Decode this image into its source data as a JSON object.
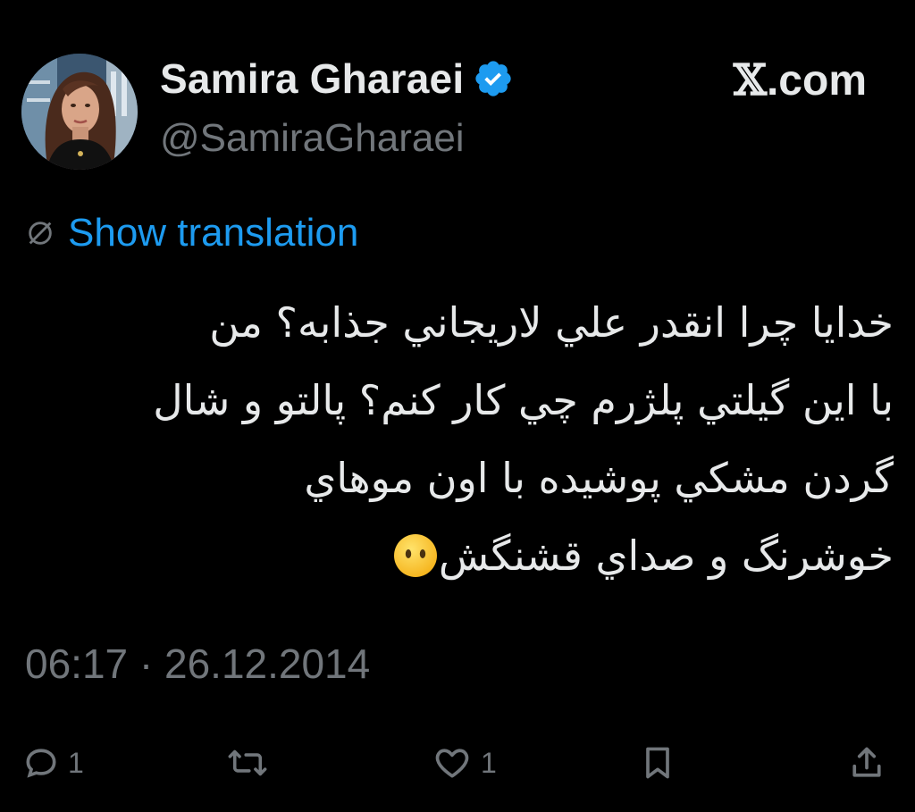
{
  "author": {
    "display_name": "Samira Gharaei",
    "handle": "@SamiraGharaei",
    "verified": true
  },
  "brand": {
    "text": ".com",
    "x_glyph": "𝕏"
  },
  "translation": {
    "label": "Show translation",
    "icon": "globe-icon"
  },
  "tweet": {
    "lines": [
      "خدايا چرا انقدر علي لاريجاني جذابه؟ من",
      "با اين گيلتي پلژرم چي كار كنم؟ پالتو و شال",
      "گردن مشكي پوشيده با اون موهاي",
      "خوشرنگ و صداي قشنگش"
    ],
    "emoji": "face-without-mouth"
  },
  "meta": {
    "timestamp": "06:17 · 26.12.2014"
  },
  "actions": {
    "reply": {
      "icon": "reply-icon",
      "count": "1"
    },
    "retweet": {
      "icon": "retweet-icon",
      "count": ""
    },
    "like": {
      "icon": "heart-icon",
      "count": "1"
    },
    "bookmark": {
      "icon": "bookmark-icon"
    },
    "share": {
      "icon": "share-icon"
    }
  },
  "colors": {
    "background": "#000000",
    "text_primary": "#e7e9ea",
    "text_secondary": "#71767b",
    "link": "#1d9bf0",
    "verified_badge": "#1d9bf0"
  }
}
